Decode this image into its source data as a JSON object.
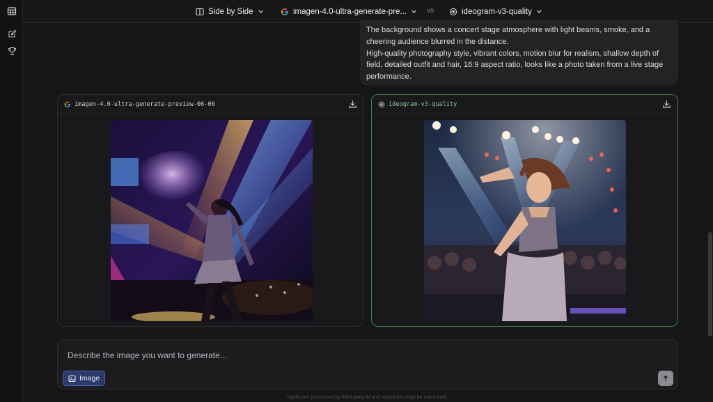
{
  "colors": {
    "accent_green": "#3f7d54",
    "image_button": "#2b3a6b"
  },
  "rail": {
    "icons": [
      "table-icon",
      "edit-icon",
      "trophy-icon"
    ]
  },
  "topbar": {
    "mode_label": "Side by Side",
    "model_a": "imagen-4.0-ultra-generate-pre...",
    "vs_label": "vs",
    "model_b": "ideogram-v3-quality"
  },
  "prompt": {
    "line1": "The background shows a concert stage atmosphere with light beams, smoke, and a cheering audience blurred in the distance.",
    "line2": "High-quality photography style, vibrant colors, motion blur for realism, shallow depth of field, detailed outfit and hair, 16:9 aspect ratio, looks like a photo taken from a live stage performance."
  },
  "cards": {
    "left": {
      "model": "imagen-4.0-ultra-generate-preview-06-06"
    },
    "right": {
      "model": "ideogram-v3-quality"
    }
  },
  "composer": {
    "placeholder": "Describe the image you want to generate...",
    "image_button_label": "Image"
  },
  "disclaimer": "Inputs are processed by third-party AI and responses may be inaccurate."
}
